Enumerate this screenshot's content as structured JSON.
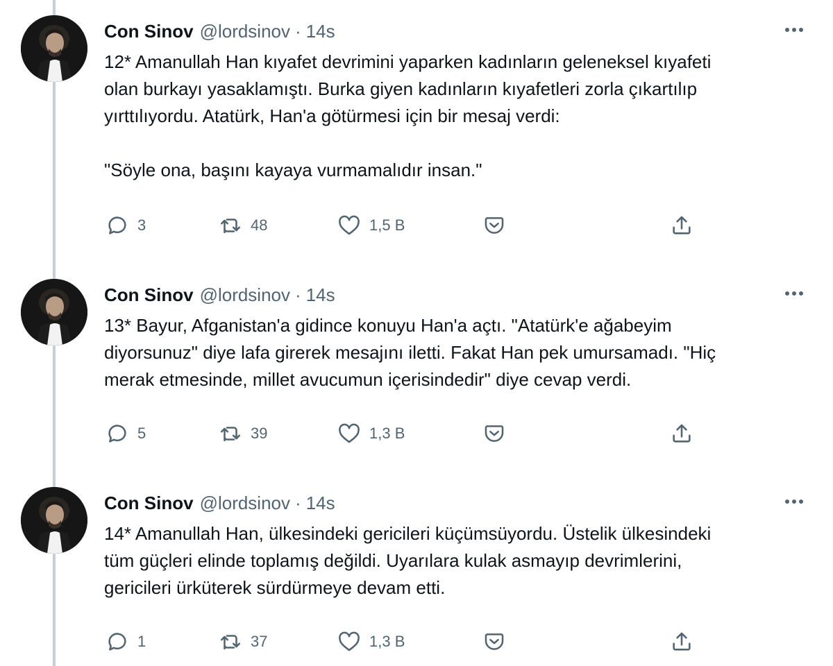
{
  "tweets": [
    {
      "author": {
        "name": "Con Sinov",
        "handle": "@lordsinov"
      },
      "time": "14s",
      "text_lines": [
        "12* Amanullah Han kıyafet devrimini yaparken kadınların geleneksel kıyafeti",
        "olan burkayı yasaklamıştı. Burka giyen kadınların kıyafetleri zorla çıkartılıp",
        "yırttılıyordu. Atatürk, Han'a götürmesi için bir mesaj verdi:",
        "",
        "\"Söyle ona, başını kayaya vurmamalıdır insan.\""
      ],
      "replies": "3",
      "retweets": "48",
      "likes": "1,5 B"
    },
    {
      "author": {
        "name": "Con Sinov",
        "handle": "@lordsinov"
      },
      "time": "14s",
      "text_lines": [
        "13* Bayur, Afganistan'a gidince konuyu Han'a açtı. \"Atatürk'e ağabeyim",
        "diyorsunuz\" diye lafa girerek mesajını iletti. Fakat Han pek umursamadı. \"Hiç",
        "merak etmesinde, millet avucumun içerisindedir\" diye cevap verdi."
      ],
      "replies": "5",
      "retweets": "39",
      "likes": "1,3 B"
    },
    {
      "author": {
        "name": "Con Sinov",
        "handle": "@lordsinov"
      },
      "time": "14s",
      "text_lines": [
        "14* Amanullah Han, ülkesindeki gericileri küçümsüyordu. Üstelik ülkesindeki",
        "tüm güçleri elinde toplamış değildi. Uyarılara kulak asmayıp devrimlerini,",
        "gericileri ürküterek sürdürmeye devam etti."
      ],
      "replies": "1",
      "retweets": "37",
      "likes": "1,3 B"
    }
  ],
  "separator": "·",
  "icons": {
    "avatar": "profile-photo",
    "more": "more-horizontal-icon",
    "reply": "reply-icon",
    "retweet": "retweet-icon",
    "like": "heart-icon",
    "dislike": "dislike-icon",
    "share": "share-icon"
  },
  "colors": {
    "text": "#0f1419",
    "secondary": "#536471",
    "thread_line": "#c4cfd6",
    "background": "#ffffff"
  }
}
